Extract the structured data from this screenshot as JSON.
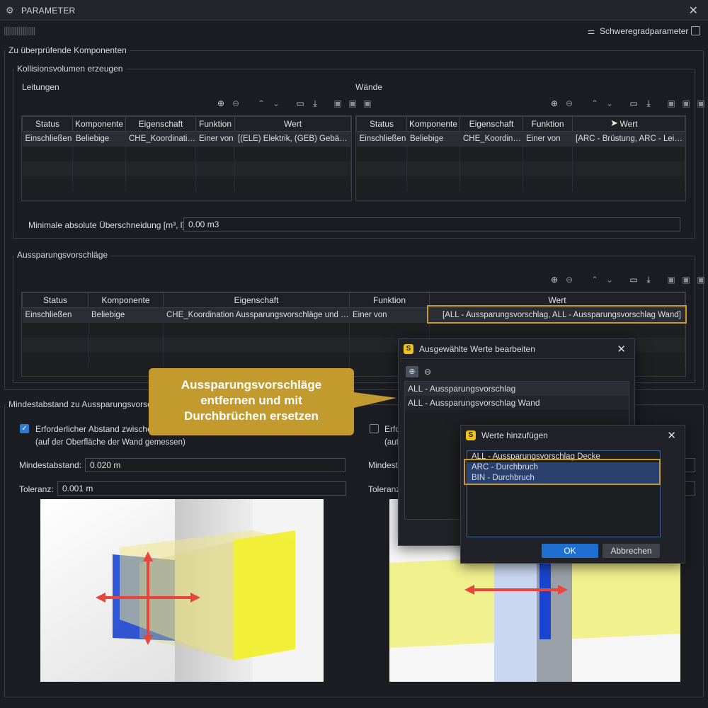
{
  "window": {
    "title": "PARAMETER"
  },
  "header": {
    "severity_label": "Schweregradparameter"
  },
  "components": {
    "legend": "Zu überprüfende Komponenten"
  },
  "collision": {
    "legend": "Kollisionsvolumen erzeugen",
    "left": {
      "title": "Leitungen",
      "columns": [
        "Status",
        "Komponente",
        "Eigenschaft",
        "Funktion",
        "Wert"
      ],
      "rows": [
        [
          "Einschließen",
          "Beliebige",
          "CHE_Koordination…",
          "Einer von",
          "[(ELE) Elektrik, (GEB) Gebäude…"
        ]
      ]
    },
    "right": {
      "title": "Wände",
      "columns": [
        "Status",
        "Komponente",
        "Eigenschaft",
        "Funktion",
        "Wert"
      ],
      "rows": [
        [
          "Einschließen",
          "Beliebige",
          "CHE_Koordinati…",
          "Einer von",
          "[ARC - Brüstung, ARC - Leich…"
        ]
      ]
    },
    "overlap_label": "Minimale absolute Überschneidung [m³, l]",
    "overlap_value": "0.00 m3"
  },
  "proposals": {
    "legend": "Aussparungsvorschläge",
    "columns": [
      "Status",
      "Komponente",
      "Eigenschaft",
      "Funktion",
      "Wert"
    ],
    "rows": [
      [
        "Einschließen",
        "Beliebige",
        "CHE_Koordination Aussparungsvorschläge und D…",
        "Einer von",
        "[ALL - Aussparungsvorschlag, ALL - Aussparungsvorschlag Wand]"
      ]
    ]
  },
  "distance": {
    "legend": "Mindestabstand zu Aussparungsvorschl",
    "left_check_label": "Erforderlicher Abstand zwischen",
    "left_check_sub": "(auf der Oberfläche der Wand gemessen)",
    "left_checked": true,
    "min_label": "Mindestabstand:",
    "min_value": "0.020 m",
    "tol_label": "Toleranz:",
    "tol_value": "0.001 m",
    "right_check_label": "Erfo",
    "right_check_sub": "(aut",
    "right_min_label": "Mindesta",
    "right_tol_label": "Toleranz"
  },
  "edit_dialog": {
    "title": "Ausgewählte Werte bearbeiten",
    "items": [
      "ALL - Aussparungsvorschlag",
      "ALL - Aussparungsvorschlag Wand"
    ]
  },
  "add_dialog": {
    "title": "Werte hinzufügen",
    "items": [
      "ALL - Aussparungsvorschlag Decke",
      "ARC - Durchbruch",
      "BIN - Durchbruch"
    ],
    "ok": "OK",
    "cancel": "Abbrechen"
  },
  "callout": {
    "line1": "Aussparungsvorschläge",
    "line2": "entfernen und mit",
    "line3": "Durchbrüchen ersetzen"
  },
  "colors": {
    "accent": "#c99a2a",
    "callout": "#c39a2e",
    "ok_button": "#1f6fd1",
    "wall_yellow": "#f2f02a",
    "blue": "#1b45d0",
    "arrow_red": "#e8453c"
  }
}
